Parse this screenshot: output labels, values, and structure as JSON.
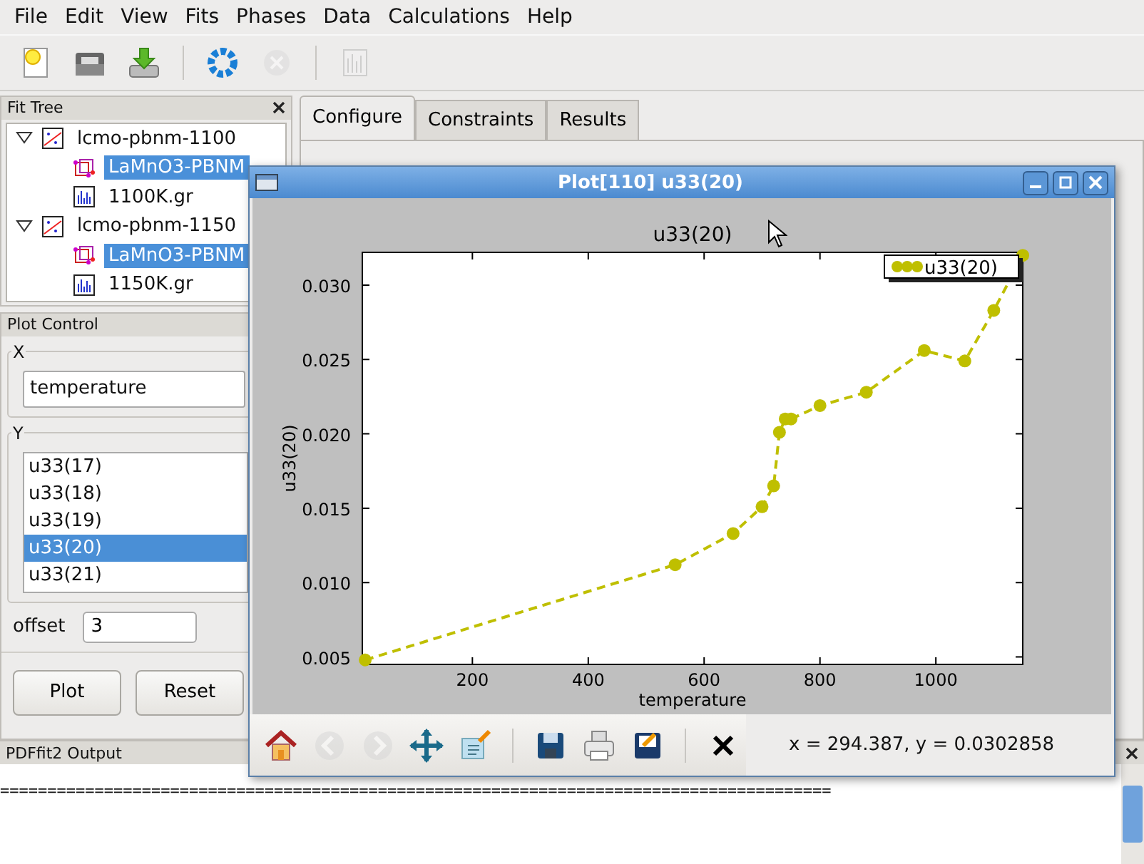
{
  "menu": [
    "File",
    "Edit",
    "View",
    "Fits",
    "Phases",
    "Data",
    "Calculations",
    "Help"
  ],
  "toolbar": [
    {
      "kind": "new",
      "disabled": false
    },
    {
      "kind": "open",
      "disabled": false
    },
    {
      "kind": "import",
      "disabled": false
    },
    {
      "kind": "sep"
    },
    {
      "kind": "run",
      "disabled": false
    },
    {
      "kind": "stop",
      "disabled": true
    },
    {
      "kind": "sep"
    },
    {
      "kind": "plot",
      "disabled": true
    }
  ],
  "fit_tree": {
    "title": "Fit Tree",
    "items": [
      {
        "label": "lcmo-pbnm-1100",
        "kind": "fit",
        "expanded": true,
        "selected": false,
        "children": [
          {
            "label": "LaMnO3-PBNM",
            "kind": "phase",
            "selected": true
          },
          {
            "label": "1100K.gr",
            "kind": "data",
            "selected": false
          }
        ]
      },
      {
        "label": "lcmo-pbnm-1150",
        "kind": "fit",
        "expanded": true,
        "selected": false,
        "children": [
          {
            "label": "LaMnO3-PBNM",
            "kind": "phase",
            "selected": true
          },
          {
            "label": "1150K.gr",
            "kind": "data",
            "selected": false
          }
        ]
      }
    ]
  },
  "plot_control": {
    "title": "Plot Control",
    "x_group": "X",
    "x_value": "temperature",
    "y_group": "Y",
    "y_items": [
      {
        "label": "u33(17)",
        "selected": false
      },
      {
        "label": "u33(18)",
        "selected": false
      },
      {
        "label": "u33(19)",
        "selected": false
      },
      {
        "label": "u33(20)",
        "selected": true
      },
      {
        "label": "u33(21)",
        "selected": false
      }
    ],
    "offset_label": "offset",
    "offset_value": "3",
    "buttons": [
      "Plot",
      "Reset"
    ]
  },
  "tabs": [
    {
      "label": "Configure",
      "selected": true
    },
    {
      "label": "Constraints",
      "selected": false
    },
    {
      "label": "Results",
      "selected": false
    }
  ],
  "output": {
    "title": "PDFfit2 Output",
    "text": "========================================================================================"
  },
  "plot_window": {
    "title": "Plot[110] u33(20)",
    "chart_data": {
      "type": "line",
      "title": "u33(20)",
      "xlabel": "temperature",
      "ylabel": "u33(20)",
      "xlim": [
        10,
        1150
      ],
      "ylim": [
        0.0045,
        0.0322
      ],
      "xticks": [
        200,
        400,
        600,
        800,
        1000
      ],
      "yticks": [
        {
          "value": 0.005,
          "label": "0.005"
        },
        {
          "value": 0.01,
          "label": "0.010"
        },
        {
          "value": 0.015,
          "label": "0.015"
        },
        {
          "value": 0.02,
          "label": "0.020"
        },
        {
          "value": 0.025,
          "label": "0.025"
        },
        {
          "value": 0.03,
          "label": "0.030"
        }
      ],
      "x": [
        15,
        550,
        650,
        700,
        720,
        730,
        740,
        750,
        800,
        880,
        980,
        1050,
        1100,
        1150
      ],
      "series": [
        {
          "name": "u33(20)",
          "color": "#bfbf00",
          "line_style": "dashed",
          "marker": "circle",
          "values": [
            0.0048,
            0.0112,
            0.0133,
            0.0151,
            0.0165,
            0.0201,
            0.021,
            0.021,
            0.0219,
            0.0228,
            0.0256,
            0.0249,
            0.0283,
            0.032
          ]
        }
      ]
    },
    "toolbar": [
      {
        "kind": "home",
        "disabled": false
      },
      {
        "kind": "back",
        "disabled": true
      },
      {
        "kind": "forward",
        "disabled": true
      },
      {
        "kind": "pan",
        "disabled": false
      },
      {
        "kind": "subplots",
        "disabled": false
      },
      {
        "kind": "sep"
      },
      {
        "kind": "save",
        "disabled": false
      },
      {
        "kind": "print",
        "disabled": false
      },
      {
        "kind": "edit",
        "disabled": false
      },
      {
        "kind": "sep"
      },
      {
        "kind": "close",
        "disabled": false
      }
    ],
    "coordinates": "x = 294.387, y = 0.0302858"
  }
}
